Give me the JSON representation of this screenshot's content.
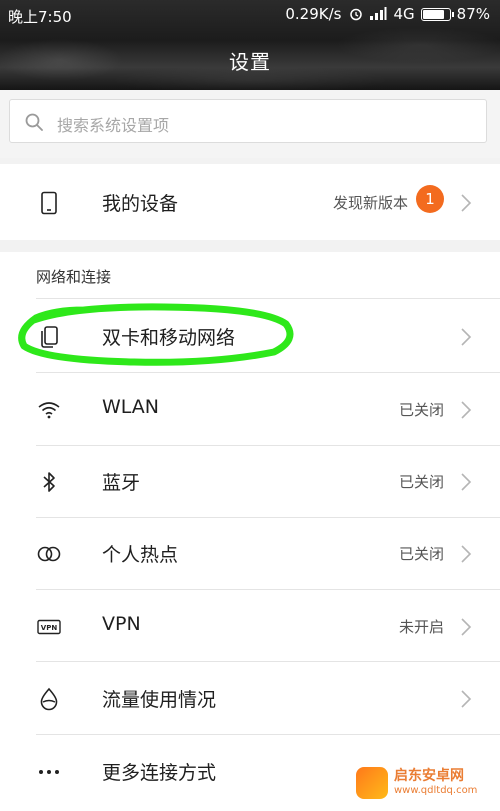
{
  "status_bar": {
    "time": "晚上7:50",
    "net_speed": "0.29K/s",
    "network": "4G",
    "battery": "87%",
    "battery_level": 0.87
  },
  "header": {
    "title": "设置"
  },
  "search": {
    "placeholder": "搜索系统设置项",
    "icon": "search-icon"
  },
  "device_card": {
    "label": "我的设备",
    "status": "发现新版本",
    "badge": "1",
    "icon": "phone-icon"
  },
  "network_section": {
    "title": "网络和连接",
    "items": [
      {
        "label": "双卡和移动网络",
        "status": "",
        "icon": "sim-cards-icon"
      },
      {
        "label": "WLAN",
        "status": "已关闭",
        "icon": "wifi-icon"
      },
      {
        "label": "蓝牙",
        "status": "已关闭",
        "icon": "bluetooth-icon"
      },
      {
        "label": "个人热点",
        "status": "已关闭",
        "icon": "hotspot-icon"
      },
      {
        "label": "VPN",
        "status": "未开启",
        "icon": "vpn-icon"
      },
      {
        "label": "流量使用情况",
        "status": "",
        "icon": "data-usage-icon"
      },
      {
        "label": "更多连接方式",
        "status": "",
        "icon": "more-icon"
      }
    ]
  },
  "annotation_color": "#2ee81a",
  "watermark": {
    "name": "启东安卓网",
    "url": "www.qdltdq.com"
  }
}
